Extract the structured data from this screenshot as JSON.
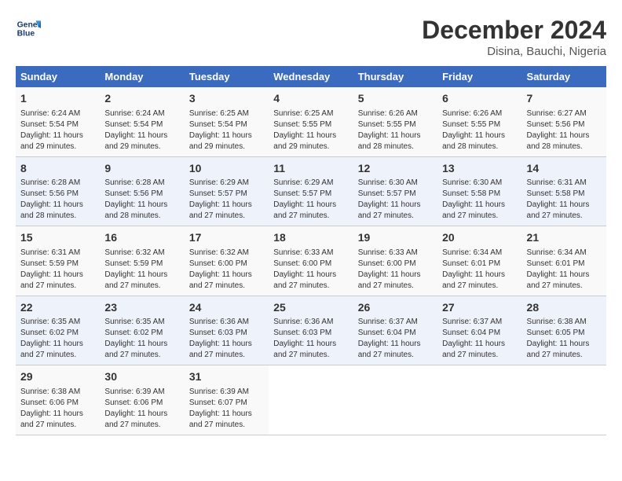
{
  "header": {
    "logo_line1": "General",
    "logo_line2": "Blue",
    "month": "December 2024",
    "location": "Disina, Bauchi, Nigeria"
  },
  "days_of_week": [
    "Sunday",
    "Monday",
    "Tuesday",
    "Wednesday",
    "Thursday",
    "Friday",
    "Saturday"
  ],
  "weeks": [
    [
      {
        "num": "1",
        "detail": "Sunrise: 6:24 AM\nSunset: 5:54 PM\nDaylight: 11 hours\nand 29 minutes."
      },
      {
        "num": "2",
        "detail": "Sunrise: 6:24 AM\nSunset: 5:54 PM\nDaylight: 11 hours\nand 29 minutes."
      },
      {
        "num": "3",
        "detail": "Sunrise: 6:25 AM\nSunset: 5:54 PM\nDaylight: 11 hours\nand 29 minutes."
      },
      {
        "num": "4",
        "detail": "Sunrise: 6:25 AM\nSunset: 5:55 PM\nDaylight: 11 hours\nand 29 minutes."
      },
      {
        "num": "5",
        "detail": "Sunrise: 6:26 AM\nSunset: 5:55 PM\nDaylight: 11 hours\nand 28 minutes."
      },
      {
        "num": "6",
        "detail": "Sunrise: 6:26 AM\nSunset: 5:55 PM\nDaylight: 11 hours\nand 28 minutes."
      },
      {
        "num": "7",
        "detail": "Sunrise: 6:27 AM\nSunset: 5:56 PM\nDaylight: 11 hours\nand 28 minutes."
      }
    ],
    [
      {
        "num": "8",
        "detail": "Sunrise: 6:28 AM\nSunset: 5:56 PM\nDaylight: 11 hours\nand 28 minutes."
      },
      {
        "num": "9",
        "detail": "Sunrise: 6:28 AM\nSunset: 5:56 PM\nDaylight: 11 hours\nand 28 minutes."
      },
      {
        "num": "10",
        "detail": "Sunrise: 6:29 AM\nSunset: 5:57 PM\nDaylight: 11 hours\nand 27 minutes."
      },
      {
        "num": "11",
        "detail": "Sunrise: 6:29 AM\nSunset: 5:57 PM\nDaylight: 11 hours\nand 27 minutes."
      },
      {
        "num": "12",
        "detail": "Sunrise: 6:30 AM\nSunset: 5:57 PM\nDaylight: 11 hours\nand 27 minutes."
      },
      {
        "num": "13",
        "detail": "Sunrise: 6:30 AM\nSunset: 5:58 PM\nDaylight: 11 hours\nand 27 minutes."
      },
      {
        "num": "14",
        "detail": "Sunrise: 6:31 AM\nSunset: 5:58 PM\nDaylight: 11 hours\nand 27 minutes."
      }
    ],
    [
      {
        "num": "15",
        "detail": "Sunrise: 6:31 AM\nSunset: 5:59 PM\nDaylight: 11 hours\nand 27 minutes."
      },
      {
        "num": "16",
        "detail": "Sunrise: 6:32 AM\nSunset: 5:59 PM\nDaylight: 11 hours\nand 27 minutes."
      },
      {
        "num": "17",
        "detail": "Sunrise: 6:32 AM\nSunset: 6:00 PM\nDaylight: 11 hours\nand 27 minutes."
      },
      {
        "num": "18",
        "detail": "Sunrise: 6:33 AM\nSunset: 6:00 PM\nDaylight: 11 hours\nand 27 minutes."
      },
      {
        "num": "19",
        "detail": "Sunrise: 6:33 AM\nSunset: 6:00 PM\nDaylight: 11 hours\nand 27 minutes."
      },
      {
        "num": "20",
        "detail": "Sunrise: 6:34 AM\nSunset: 6:01 PM\nDaylight: 11 hours\nand 27 minutes."
      },
      {
        "num": "21",
        "detail": "Sunrise: 6:34 AM\nSunset: 6:01 PM\nDaylight: 11 hours\nand 27 minutes."
      }
    ],
    [
      {
        "num": "22",
        "detail": "Sunrise: 6:35 AM\nSunset: 6:02 PM\nDaylight: 11 hours\nand 27 minutes."
      },
      {
        "num": "23",
        "detail": "Sunrise: 6:35 AM\nSunset: 6:02 PM\nDaylight: 11 hours\nand 27 minutes."
      },
      {
        "num": "24",
        "detail": "Sunrise: 6:36 AM\nSunset: 6:03 PM\nDaylight: 11 hours\nand 27 minutes."
      },
      {
        "num": "25",
        "detail": "Sunrise: 6:36 AM\nSunset: 6:03 PM\nDaylight: 11 hours\nand 27 minutes."
      },
      {
        "num": "26",
        "detail": "Sunrise: 6:37 AM\nSunset: 6:04 PM\nDaylight: 11 hours\nand 27 minutes."
      },
      {
        "num": "27",
        "detail": "Sunrise: 6:37 AM\nSunset: 6:04 PM\nDaylight: 11 hours\nand 27 minutes."
      },
      {
        "num": "28",
        "detail": "Sunrise: 6:38 AM\nSunset: 6:05 PM\nDaylight: 11 hours\nand 27 minutes."
      }
    ],
    [
      {
        "num": "29",
        "detail": "Sunrise: 6:38 AM\nSunset: 6:06 PM\nDaylight: 11 hours\nand 27 minutes."
      },
      {
        "num": "30",
        "detail": "Sunrise: 6:39 AM\nSunset: 6:06 PM\nDaylight: 11 hours\nand 27 minutes."
      },
      {
        "num": "31",
        "detail": "Sunrise: 6:39 AM\nSunset: 6:07 PM\nDaylight: 11 hours\nand 27 minutes."
      },
      null,
      null,
      null,
      null
    ]
  ]
}
